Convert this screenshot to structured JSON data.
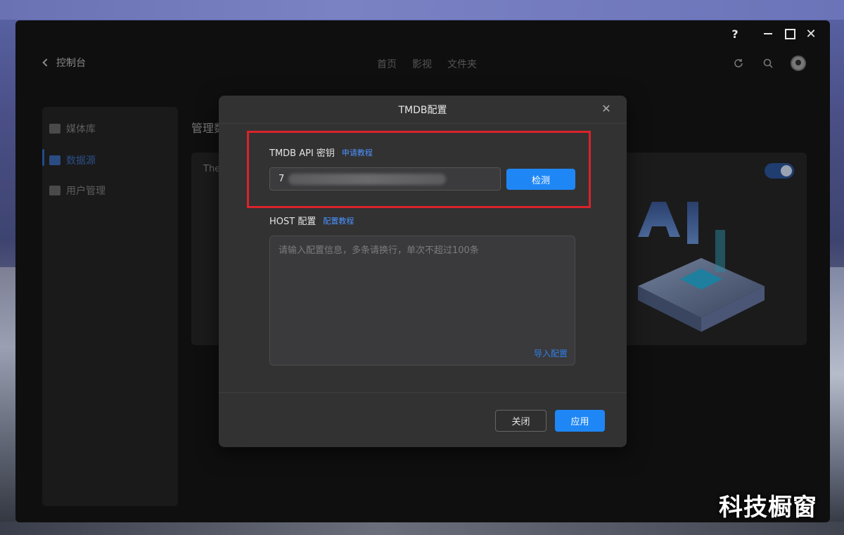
{
  "window": {
    "help_label": "?",
    "close_label": "✕"
  },
  "topbar": {
    "back_label": "控制台",
    "nav": [
      "首页",
      "影视",
      "文件夹"
    ]
  },
  "sidebar": {
    "items": [
      {
        "label": "媒体库",
        "icon": "play-square-icon"
      },
      {
        "label": "数据源",
        "icon": "chart-icon"
      },
      {
        "label": "用户管理",
        "icon": "user-chart-icon"
      }
    ],
    "active_index": 1
  },
  "main": {
    "title": "管理数",
    "panel_label": "The",
    "toggle_on": true
  },
  "dialog": {
    "title": "TMDB配置",
    "close_label": "✕",
    "api_label": "TMDB API 密钥",
    "api_link": "申请教程",
    "api_value": "7",
    "detect_button": "检测",
    "host_label": "HOST 配置",
    "host_link": "配置教程",
    "host_placeholder": "请输入配置信息，多条请换行，单次不超过100条",
    "import_link": "导入配置",
    "close_button": "关闭",
    "apply_button": "应用"
  },
  "watermark": "科技橱窗",
  "colors": {
    "accent": "#1f87f5",
    "highlight": "#d9232a",
    "dialog_bg": "#323233",
    "window_bg": "#0f0f10"
  }
}
